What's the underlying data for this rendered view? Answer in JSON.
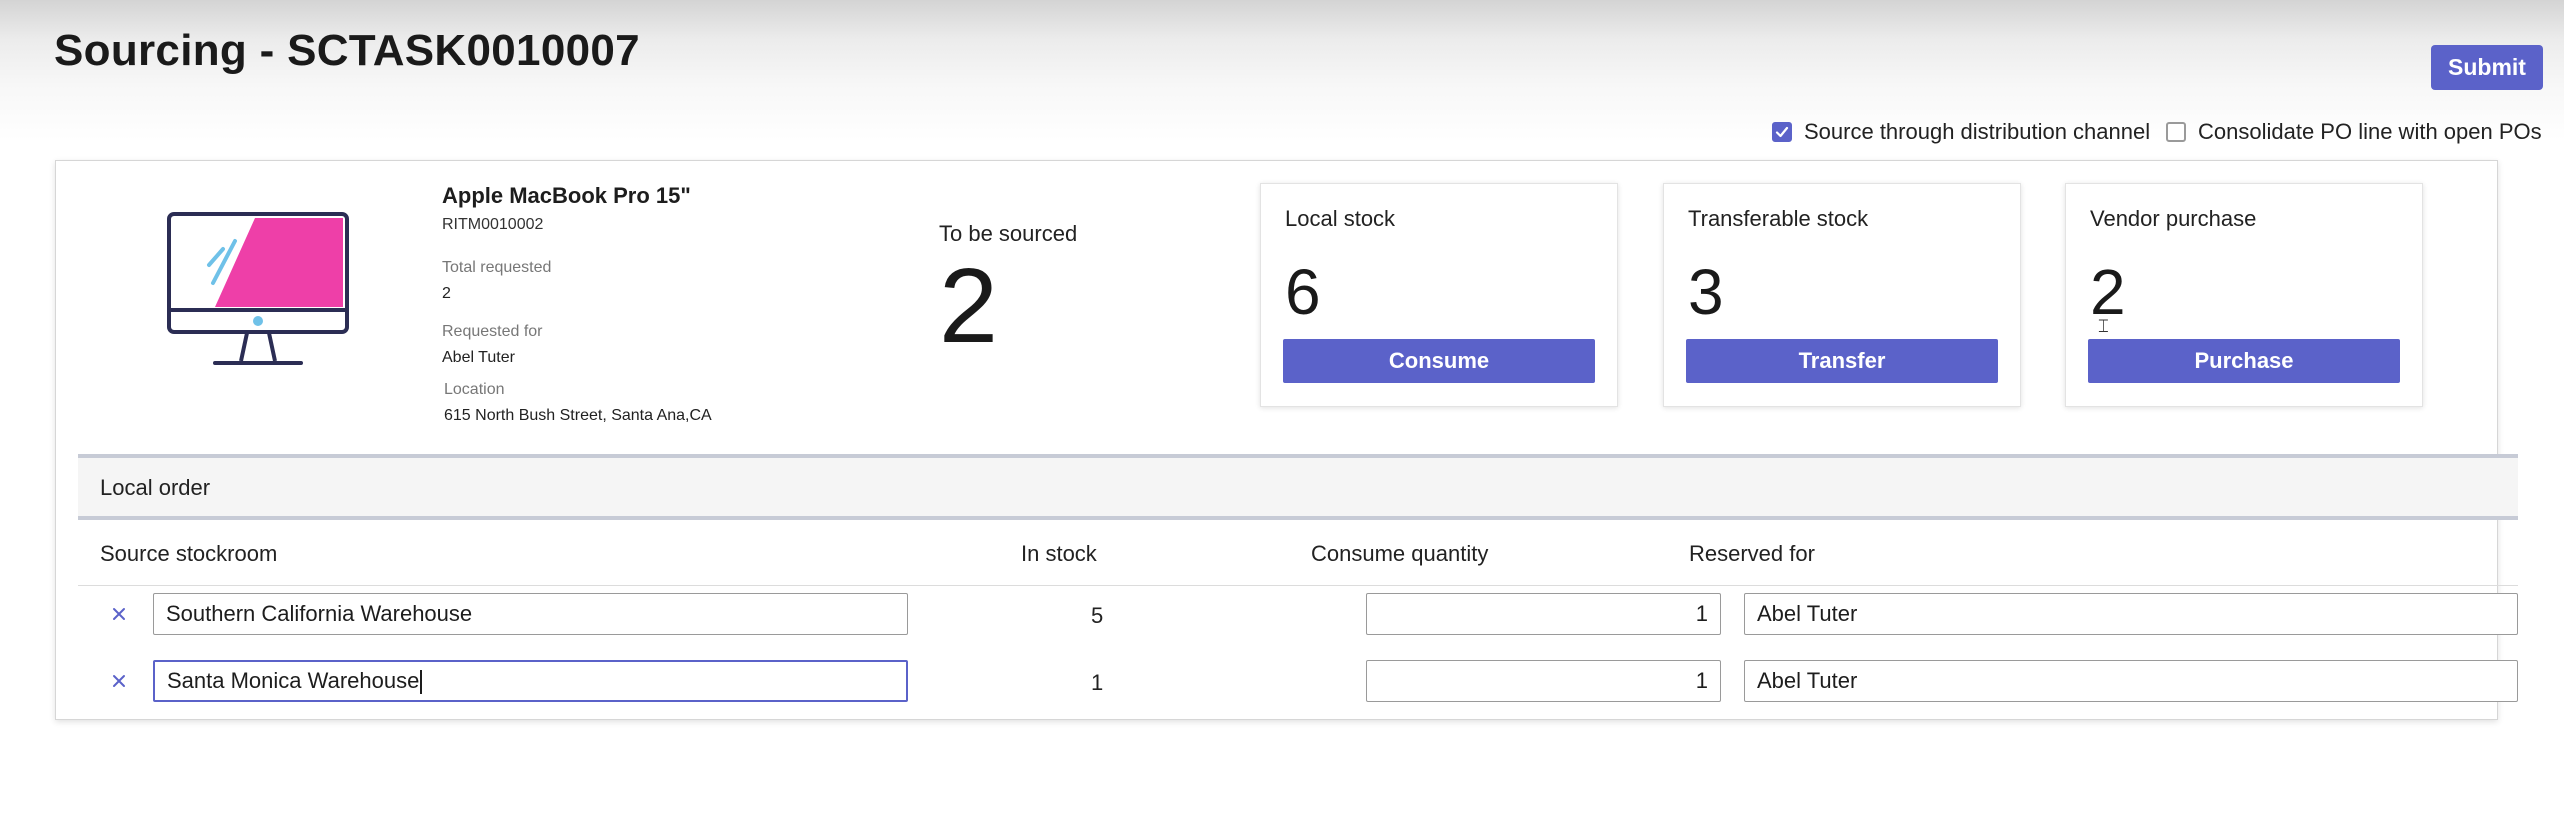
{
  "header": {
    "title": "Sourcing - SCTASK0010007",
    "submit_label": "Submit"
  },
  "options": [
    {
      "label": "Source through distribution channel",
      "checked": true
    },
    {
      "label": "Consolidate PO line with open POs",
      "checked": false
    }
  ],
  "item": {
    "name": "Apple MacBook Pro 15\"",
    "ritm": "RITM0010002",
    "total_requested_label": "Total requested",
    "total_requested": "2",
    "requested_for_label": "Requested for",
    "requested_for": "Abel Tuter",
    "location_label": "Location",
    "location": "615 North Bush Street, Santa Ana,CA"
  },
  "to_be_sourced": {
    "label": "To be sourced",
    "value": "2"
  },
  "stock_cards": [
    {
      "label": "Local stock",
      "value": "6",
      "button": "Consume"
    },
    {
      "label": "Transferable stock",
      "value": "3",
      "button": "Transfer"
    },
    {
      "label": "Vendor purchase",
      "value": "2",
      "button": "Purchase"
    }
  ],
  "local_order": {
    "title": "Local order",
    "columns": [
      "Source stockroom",
      "In stock",
      "Consume quantity",
      "Reserved for"
    ],
    "rows": [
      {
        "stockroom": "Southern California Warehouse",
        "in_stock": "5",
        "quantity": "1",
        "reserved_for": "Abel Tuter"
      },
      {
        "stockroom": "Santa Monica Warehouse",
        "in_stock": "1",
        "quantity": "1",
        "reserved_for": "Abel Tuter"
      }
    ]
  },
  "colors": {
    "accent": "#5b62c9",
    "monitor_screen": "#ee3fa8",
    "monitor_outline": "#2b2d54"
  }
}
